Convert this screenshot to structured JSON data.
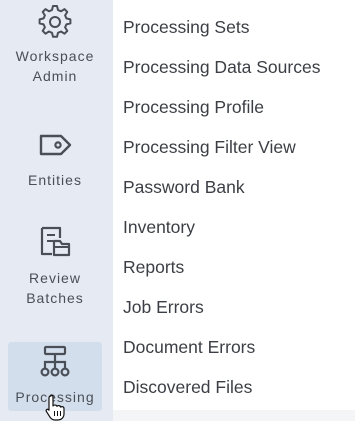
{
  "rail": {
    "items": [
      {
        "label": "Workspace Admin",
        "icon": "gear-icon"
      },
      {
        "label": "Entities",
        "icon": "tag-icon"
      },
      {
        "label": "Review Batches",
        "icon": "batches-icon"
      },
      {
        "label": "Processing",
        "icon": "hierarchy-icon",
        "active": true
      }
    ]
  },
  "menu": {
    "items": [
      "Processing Sets",
      "Processing Data Sources",
      "Processing Profile",
      "Processing Filter View",
      "Password Bank",
      "Inventory",
      "Reports",
      "Job Errors",
      "Document Errors",
      "Discovered Files"
    ]
  },
  "colors": {
    "rail_bg": "#e6ebf3",
    "active_bg": "#d3deec",
    "icon": "#4a4f57",
    "menu_text": "#3b3f45"
  }
}
